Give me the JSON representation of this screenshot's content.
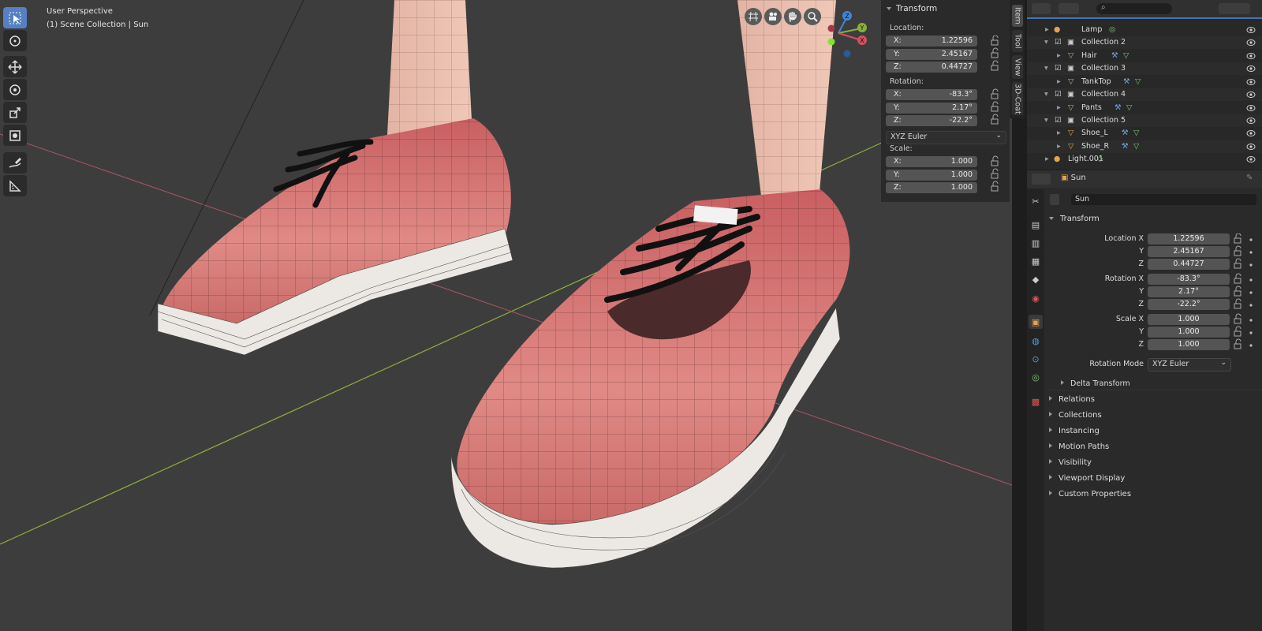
{
  "viewport": {
    "title": "User Perspective",
    "subtitle": "(1) Scene Collection | Sun"
  },
  "toolbar": {
    "tools": [
      "select-box",
      "cursor",
      "move",
      "rotate",
      "scale",
      "transform",
      "annotate",
      "measure"
    ],
    "active": "select-box"
  },
  "gizmo": {
    "x": "X",
    "y": "Y",
    "z": "Z"
  },
  "npanel": {
    "header": "Transform",
    "tabs": [
      "Item",
      "Tool",
      "View",
      "3D-Coat"
    ],
    "location_label": "Location:",
    "location": [
      {
        "axis": "X:",
        "value": "1.22596"
      },
      {
        "axis": "Y:",
        "value": "2.45167"
      },
      {
        "axis": "Z:",
        "value": "0.44727"
      }
    ],
    "rotation_label": "Rotation:",
    "rotation": [
      {
        "axis": "X:",
        "value": "-83.3°"
      },
      {
        "axis": "Y:",
        "value": "2.17°"
      },
      {
        "axis": "Z:",
        "value": "-22.2°"
      }
    ],
    "rotation_mode": "XYZ Euler",
    "scale_label": "Scale:",
    "scale": [
      {
        "axis": "X:",
        "value": "1.000"
      },
      {
        "axis": "Y:",
        "value": "1.000"
      },
      {
        "axis": "Z:",
        "value": "1.000"
      }
    ]
  },
  "outliner": {
    "rows": [
      {
        "name": "Lamp",
        "type": "object"
      },
      {
        "name": "Collection 2",
        "type": "collection"
      },
      {
        "name": "Hair",
        "type": "mesh"
      },
      {
        "name": "Collection 3",
        "type": "collection"
      },
      {
        "name": "TankTop",
        "type": "mesh"
      },
      {
        "name": "Collection 4",
        "type": "collection"
      },
      {
        "name": "Pants",
        "type": "mesh"
      },
      {
        "name": "Collection 5",
        "type": "collection"
      },
      {
        "name": "Shoe_L",
        "type": "mesh"
      },
      {
        "name": "Shoe_R",
        "type": "mesh"
      },
      {
        "name": "Light.001",
        "type": "light"
      }
    ]
  },
  "properties": {
    "header_object": "Sun",
    "name_field": "Sun",
    "section": "Transform",
    "location_label": "Location X",
    "location": [
      "1.22596",
      "2.45167",
      "0.44727"
    ],
    "rotation_label": "Rotation X",
    "rotation": [
      "-83.3°",
      "2.17°",
      "-22.2°"
    ],
    "scale_label": "Scale X",
    "scale": [
      "1.000",
      "1.000",
      "1.000"
    ],
    "y_label": "Y",
    "z_label": "Z",
    "rotation_mode_label": "Rotation Mode",
    "rotation_mode": "XYZ Euler",
    "delta": "Delta Transform",
    "sections": [
      "Relations",
      "Collections",
      "Instancing",
      "Motion Paths",
      "Visibility",
      "Viewport Display",
      "Custom Properties"
    ]
  },
  "colors": {
    "accent": "#5680c2",
    "viewport_bg": "#3d3d3d",
    "shoe": "#d97a78",
    "axis_x": "#d6505c",
    "axis_y": "#86b23a",
    "axis_z": "#3f86d6"
  }
}
